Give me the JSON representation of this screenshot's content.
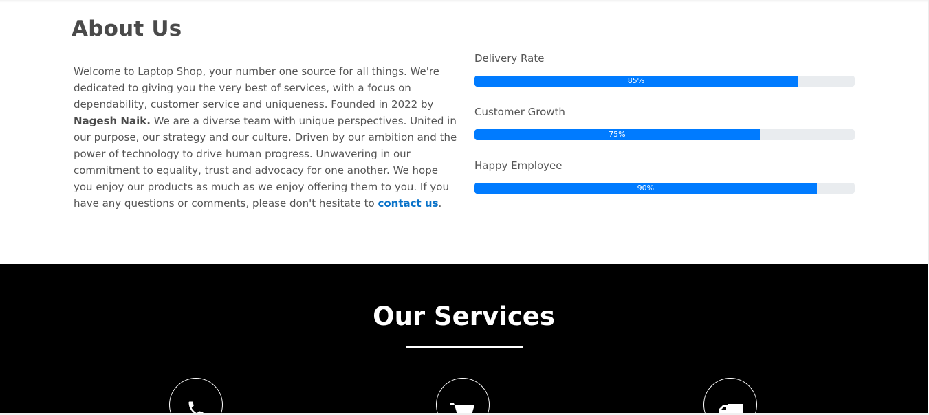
{
  "about": {
    "title": "About Us",
    "text_1": "Welcome to Laptop Shop, your number one source for all things. We're dedicated to giving you the very best of services, with a focus on dependability, customer service and uniqueness. Founded in 2022 by ",
    "founder": "Nagesh Naik.",
    "text_2": " We are a diverse team with unique perspectives. United in our purpose, our strategy and our culture. Driven by our ambition and the power of technology to drive human progress. Unwavering in our commitment to equality, trust and advocacy for one another. We hope you enjoy our products as much as we enjoy offering them to you. If you have any questions or comments, please don't hesitate to ",
    "contact_link": "contact us",
    "text_end": "."
  },
  "stats": [
    {
      "label": "Delivery Rate",
      "value": 85,
      "value_label": "85%"
    },
    {
      "label": "Customer Growth",
      "value": 75,
      "value_label": "75%"
    },
    {
      "label": "Happy Employee",
      "value": 90,
      "value_label": "90%"
    }
  ],
  "services": {
    "title": "Our Services",
    "icons": [
      "phone-icon",
      "cart-icon",
      "truck-icon"
    ]
  },
  "colors": {
    "progress_fill": "#007bff",
    "progress_track": "#e9ecef",
    "link": "#0a73c9",
    "services_bg": "#000000"
  }
}
